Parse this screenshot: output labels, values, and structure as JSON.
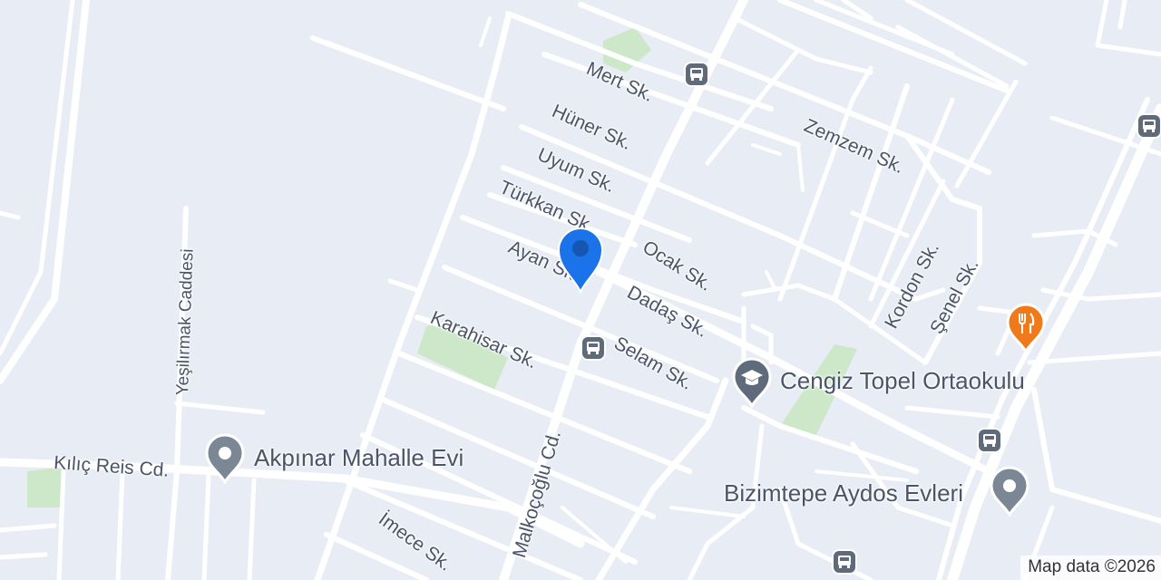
{
  "map": {
    "streets": [
      {
        "id": "mert",
        "name": "Mert Sk."
      },
      {
        "id": "huner",
        "name": "Hüner Sk."
      },
      {
        "id": "uyum",
        "name": "Uyum Sk."
      },
      {
        "id": "turkkan",
        "name": "Türkkan Sk."
      },
      {
        "id": "ayan",
        "name": "Ayan Sk."
      },
      {
        "id": "ocak",
        "name": "Ocak Sk."
      },
      {
        "id": "dadas",
        "name": "Dadaş Sk."
      },
      {
        "id": "selam",
        "name": "Selam Sk."
      },
      {
        "id": "karahisar",
        "name": "Karahisar Sk."
      },
      {
        "id": "zemzem",
        "name": "Zemzem Sk."
      },
      {
        "id": "kordon",
        "name": "Kordon Sk."
      },
      {
        "id": "senel",
        "name": "Şenel Sk."
      },
      {
        "id": "yesilirmak",
        "name": "Yeşilırmak Caddesi"
      },
      {
        "id": "kilicreis",
        "name": "Kılıç Reis Cd."
      },
      {
        "id": "malkocoglu",
        "name": "Malkoçoğlu Cd."
      },
      {
        "id": "imece",
        "name": "İmece Sk."
      }
    ],
    "places": [
      {
        "id": "cengiz",
        "name": "Cengiz Topel Ortaokulu",
        "icon": "school-icon",
        "color": "#5f6b7a"
      },
      {
        "id": "akpinar",
        "name": "Akpınar Mahalle Evi",
        "icon": "place-pin-icon",
        "color": "#7b8794"
      },
      {
        "id": "bizimtepe",
        "name": "Bizimtepe Aydos Evleri",
        "icon": "place-pin-icon",
        "color": "#7b8794"
      },
      {
        "id": "restaurant",
        "name": "",
        "icon": "restaurant-icon",
        "color": "#f07a1a"
      }
    ],
    "transit_icon": "bus-stop-icon",
    "location_marker_icon": "location-marker-icon",
    "colors": {
      "background": "#e8ecf4",
      "road": "#ffffff",
      "park": "#cde8c8",
      "label": "#4b5468",
      "marker": "#1a73e8",
      "transit": "#5f6b7a"
    },
    "attribution": "Map data ©2026"
  }
}
